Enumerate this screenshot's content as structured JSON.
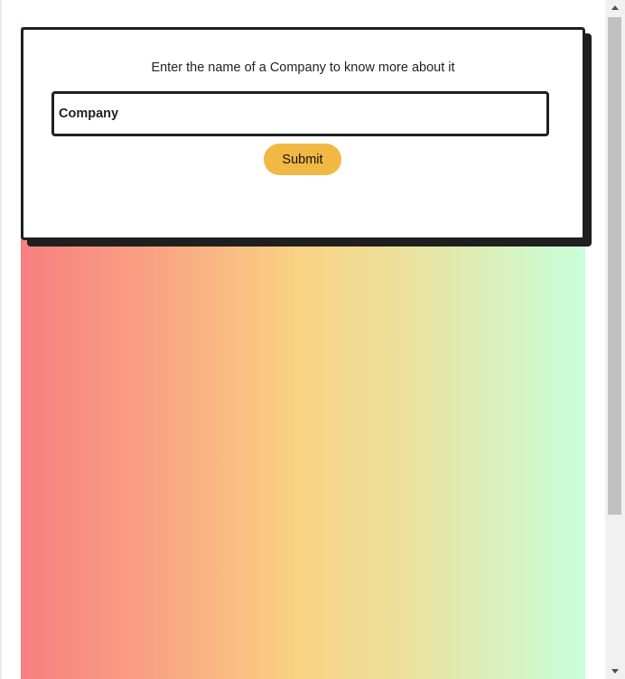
{
  "form": {
    "prompt": "Enter the name of a Company to know more about it",
    "company_input": {
      "value": "",
      "placeholder": "Company"
    },
    "submit_label": "Submit"
  },
  "colors": {
    "card_border": "#1f1f1f",
    "button": "#f1b843",
    "gradient": [
      "#f77f80",
      "#f9a083",
      "#f9d283",
      "#ece09a",
      "#c8ffdb"
    ]
  },
  "icons": {
    "scroll_up": "scroll-up-arrow-icon",
    "scroll_down": "scroll-down-arrow-icon"
  }
}
